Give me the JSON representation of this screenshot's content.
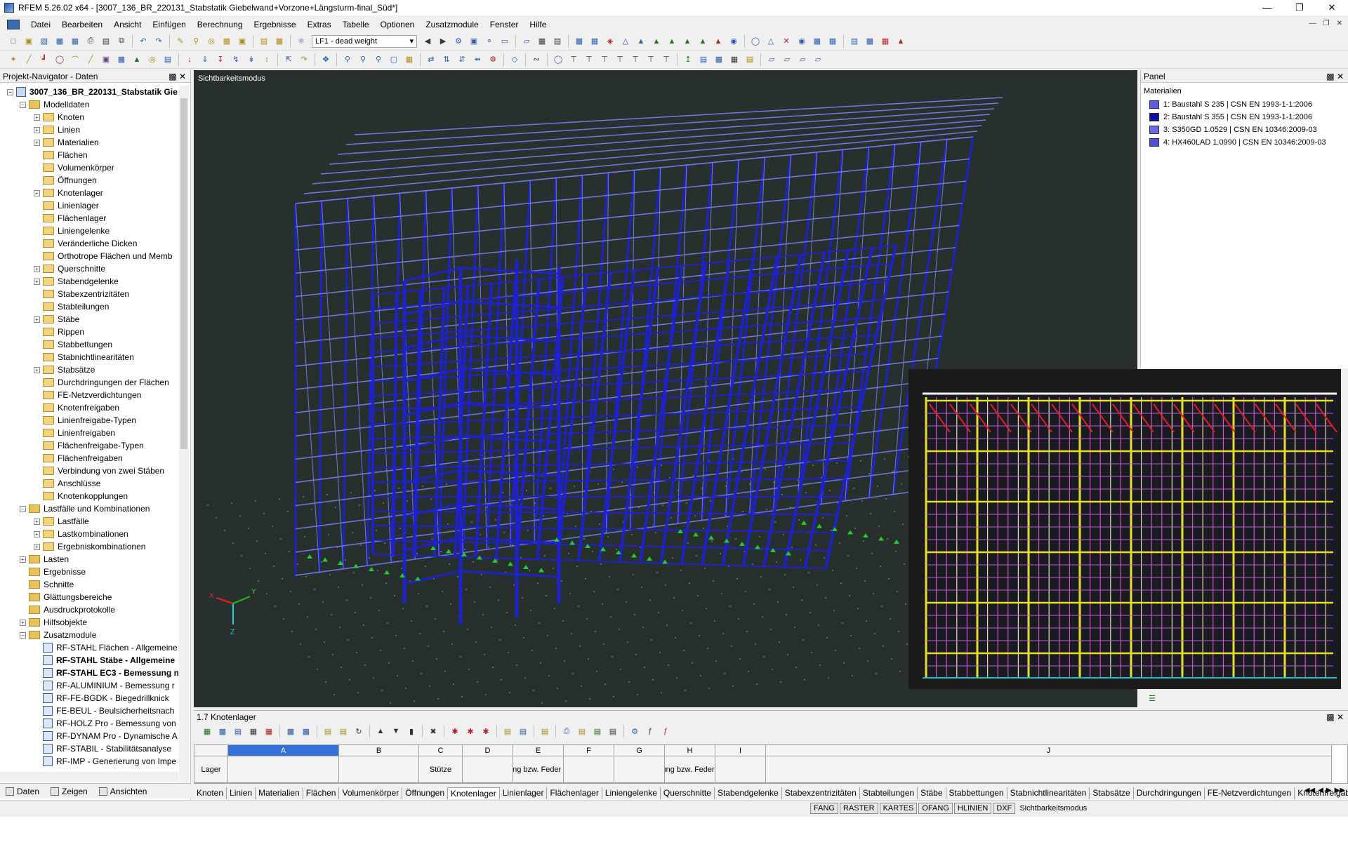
{
  "window": {
    "title": "RFEM 5.26.02 x64 - [3007_136_BR_220131_Stabstatik Giebelwand+Vorzone+Längsturm-final_Süd*]",
    "controls": [
      "—",
      "❐",
      "✕"
    ]
  },
  "menu": [
    "Datei",
    "Bearbeiten",
    "Ansicht",
    "Einfügen",
    "Berechnung",
    "Ergebnisse",
    "Extras",
    "Tabelle",
    "Optionen",
    "Zusatzmodule",
    "Fenster",
    "Hilfe"
  ],
  "toolbar": {
    "loadcase_combo": "LF1 - dead weight"
  },
  "navigator": {
    "title": "Projekt-Navigator - Daten",
    "root": "3007_136_BR_220131_Stabstatik Gie",
    "items": [
      {
        "label": "Modelldaten",
        "level": 1,
        "exp": "-",
        "icon": "folder"
      },
      {
        "label": "Knoten",
        "level": 2,
        "exp": "+",
        "icon": "item"
      },
      {
        "label": "Linien",
        "level": 2,
        "exp": "+",
        "icon": "item"
      },
      {
        "label": "Materialien",
        "level": 2,
        "exp": "+",
        "icon": "item"
      },
      {
        "label": "Flächen",
        "level": 2,
        "exp": "",
        "icon": "item"
      },
      {
        "label": "Volumenkörper",
        "level": 2,
        "exp": "",
        "icon": "item"
      },
      {
        "label": "Öffnungen",
        "level": 2,
        "exp": "",
        "icon": "item"
      },
      {
        "label": "Knotenlager",
        "level": 2,
        "exp": "+",
        "icon": "item"
      },
      {
        "label": "Linienlager",
        "level": 2,
        "exp": "",
        "icon": "item"
      },
      {
        "label": "Flächenlager",
        "level": 2,
        "exp": "",
        "icon": "item"
      },
      {
        "label": "Liniengelenke",
        "level": 2,
        "exp": "",
        "icon": "item"
      },
      {
        "label": "Veränderliche Dicken",
        "level": 2,
        "exp": "",
        "icon": "item"
      },
      {
        "label": "Orthotrope Flächen und Memb",
        "level": 2,
        "exp": "",
        "icon": "item"
      },
      {
        "label": "Querschnitte",
        "level": 2,
        "exp": "+",
        "icon": "item"
      },
      {
        "label": "Stabendgelenke",
        "level": 2,
        "exp": "+",
        "icon": "item"
      },
      {
        "label": "Stabexzentrizitäten",
        "level": 2,
        "exp": "",
        "icon": "item"
      },
      {
        "label": "Stabteilungen",
        "level": 2,
        "exp": "",
        "icon": "item"
      },
      {
        "label": "Stäbe",
        "level": 2,
        "exp": "+",
        "icon": "item"
      },
      {
        "label": "Rippen",
        "level": 2,
        "exp": "",
        "icon": "item"
      },
      {
        "label": "Stabbettungen",
        "level": 2,
        "exp": "",
        "icon": "item"
      },
      {
        "label": "Stabnichtlinearitäten",
        "level": 2,
        "exp": "",
        "icon": "item"
      },
      {
        "label": "Stabsätze",
        "level": 2,
        "exp": "+",
        "icon": "item"
      },
      {
        "label": "Durchdringungen der Flächen",
        "level": 2,
        "exp": "",
        "icon": "item"
      },
      {
        "label": "FE-Netzverdichtungen",
        "level": 2,
        "exp": "",
        "icon": "item"
      },
      {
        "label": "Knotenfreigaben",
        "level": 2,
        "exp": "",
        "icon": "item"
      },
      {
        "label": "Linienfreigabe-Typen",
        "level": 2,
        "exp": "",
        "icon": "item"
      },
      {
        "label": "Linienfreigaben",
        "level": 2,
        "exp": "",
        "icon": "item"
      },
      {
        "label": "Flächenfreigabe-Typen",
        "level": 2,
        "exp": "",
        "icon": "item"
      },
      {
        "label": "Flächenfreigaben",
        "level": 2,
        "exp": "",
        "icon": "item"
      },
      {
        "label": "Verbindung von zwei Stäben",
        "level": 2,
        "exp": "",
        "icon": "item"
      },
      {
        "label": "Anschlüsse",
        "level": 2,
        "exp": "",
        "icon": "item"
      },
      {
        "label": "Knotenkopplungen",
        "level": 2,
        "exp": "",
        "icon": "item"
      },
      {
        "label": "Lastfälle und Kombinationen",
        "level": 1,
        "exp": "-",
        "icon": "folder"
      },
      {
        "label": "Lastfälle",
        "level": 2,
        "exp": "+",
        "icon": "item"
      },
      {
        "label": "Lastkombinationen",
        "level": 2,
        "exp": "+",
        "icon": "item"
      },
      {
        "label": "Ergebniskombinationen",
        "level": 2,
        "exp": "+",
        "icon": "item"
      },
      {
        "label": "Lasten",
        "level": 1,
        "exp": "+",
        "icon": "folder"
      },
      {
        "label": "Ergebnisse",
        "level": 1,
        "exp": "",
        "icon": "folder"
      },
      {
        "label": "Schnitte",
        "level": 1,
        "exp": "",
        "icon": "folder"
      },
      {
        "label": "Glättungsbereiche",
        "level": 1,
        "exp": "",
        "icon": "folder"
      },
      {
        "label": "Ausdruckprotokolle",
        "level": 1,
        "exp": "",
        "icon": "folder"
      },
      {
        "label": "Hilfsobjekte",
        "level": 1,
        "exp": "+",
        "icon": "folder"
      },
      {
        "label": "Zusatzmodule",
        "level": 1,
        "exp": "-",
        "icon": "folder"
      },
      {
        "label": "RF-STAHL Flächen - Allgemeine",
        "level": 2,
        "exp": "",
        "icon": "module"
      },
      {
        "label": "RF-STAHL Stäbe - Allgemeine",
        "level": 2,
        "exp": "",
        "icon": "module",
        "bold": true
      },
      {
        "label": "RF-STAHL EC3 - Bemessung n",
        "level": 2,
        "exp": "",
        "icon": "module",
        "bold": true
      },
      {
        "label": "RF-ALUMINIUM - Bemessung r",
        "level": 2,
        "exp": "",
        "icon": "module"
      },
      {
        "label": "RF-FE-BGDK - Biegedrillknick",
        "level": 2,
        "exp": "",
        "icon": "module"
      },
      {
        "label": "FE-BEUL - Beulsicherheitsnach",
        "level": 2,
        "exp": "",
        "icon": "module"
      },
      {
        "label": "RF-HOLZ Pro - Bemessung von",
        "level": 2,
        "exp": "",
        "icon": "module"
      },
      {
        "label": "RF-DYNAM Pro - Dynamische A",
        "level": 2,
        "exp": "",
        "icon": "module"
      },
      {
        "label": "RF-STABIL - Stabilitätsanalyse",
        "level": 2,
        "exp": "",
        "icon": "module"
      },
      {
        "label": "RF-IMP - Generierung von Impe",
        "level": 2,
        "exp": "",
        "icon": "module"
      }
    ],
    "tabs": [
      "Daten",
      "Zeigen",
      "Ansichten"
    ]
  },
  "viewport": {
    "mode_label": "Sichtbarkeitsmodus",
    "axes": {
      "x": "X",
      "y": "Y",
      "z": "Z"
    },
    "colors": {
      "background": "#27302c",
      "steel": "#1e22c8",
      "bracing": "#6f79e6",
      "supports": "#22cc33"
    }
  },
  "panel": {
    "title": "Panel",
    "section": "Materialien",
    "materials": [
      {
        "label": "1: Baustahl S 235 | CSN EN 1993-1-1:2006",
        "color": "#5a5af0"
      },
      {
        "label": "2: Baustahl S 355 | CSN EN 1993-1-1:2006",
        "color": "#1010a0"
      },
      {
        "label": "3: S350GD 1.0529 | CSN EN 10346:2009-03",
        "color": "#6a6ae8"
      },
      {
        "label": "4: HX460LAD 1.0990 | CSN EN 10346:2009-03",
        "color": "#5050e0"
      }
    ]
  },
  "table": {
    "title": "1.7 Knotenlager",
    "columns": [
      {
        "letter": "",
        "label": "Lager"
      },
      {
        "letter": "A",
        "label": ""
      },
      {
        "letter": "B",
        "label": ""
      },
      {
        "letter": "C",
        "label": "Stütze"
      },
      {
        "letter": "D",
        "label": ""
      },
      {
        "letter": "E",
        "label": "Stützung bzw. Feder [kN/m]"
      },
      {
        "letter": "F",
        "label": ""
      },
      {
        "letter": "G",
        "label": ""
      },
      {
        "letter": "H",
        "label": "Einspannung bzw. Feder [kNm/rad]"
      },
      {
        "letter": "I",
        "label": ""
      },
      {
        "letter": "J",
        "label": ""
      }
    ],
    "sheet_tabs": [
      "Knoten",
      "Linien",
      "Materialien",
      "Flächen",
      "Volumenkörper",
      "Öffnungen",
      "Knotenlager",
      "Linienlager",
      "Flächenlager",
      "Liniengelenke",
      "Querschnitte",
      "Stabendgelenke",
      "Stabexzentrizitäten",
      "Stabteilungen",
      "Stäbe",
      "Stabbettungen",
      "Stabnichtlinearitäten",
      "Stabsätze",
      "Durchdringungen",
      "FE-Netzverdichtungen",
      "Knotenfreigaben"
    ],
    "active_tab": "Knotenlager"
  },
  "status": {
    "cells": [
      "FANG",
      "RASTER",
      "KARTES",
      "OFANG",
      "HLINIEN",
      "DXF"
    ],
    "mode": "Sichtbarkeitsmodus"
  }
}
